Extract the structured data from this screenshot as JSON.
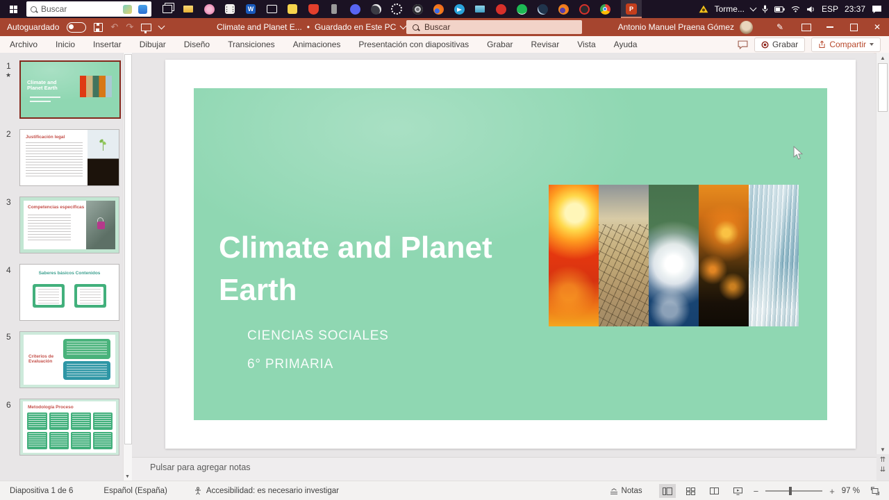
{
  "taskbar": {
    "search_placeholder": "Buscar",
    "app_icons": [
      "task-view",
      "file-explorer",
      "photos",
      "store",
      "word",
      "chat",
      "sticky-notes",
      "brave",
      "phone-link",
      "discord",
      "obs",
      "settings",
      "screen-record",
      "firefox",
      "telegram",
      "mail",
      "camera-record",
      "spotify",
      "steam",
      "firefox-nightly",
      "recorder",
      "chrome",
      "powerpoint"
    ],
    "tray": {
      "weather_label": "Torme...",
      "language": "ESP",
      "time": "23:37"
    }
  },
  "titlebar": {
    "autosave_label": "Autoguardado",
    "doc_title": "Climate and Planet E...",
    "separator": "•",
    "saved_status": "Guardado en Este PC",
    "search_placeholder": "Buscar",
    "user_name": "Antonio Manuel Praena Gómez"
  },
  "ribbon": {
    "tabs": [
      "Archivo",
      "Inicio",
      "Insertar",
      "Dibujar",
      "Diseño",
      "Transiciones",
      "Animaciones",
      "Presentación con diapositivas",
      "Grabar",
      "Revisar",
      "Vista",
      "Ayuda"
    ],
    "record_label": "Grabar",
    "share_label": "Compartir"
  },
  "slides_panel": {
    "thumbnails": [
      {
        "number": "1",
        "title": "Climate and Planet Earth"
      },
      {
        "number": "2",
        "title": "Justificación legal"
      },
      {
        "number": "3",
        "title": "Competencias específicas"
      },
      {
        "number": "4",
        "title": "Saberes básicos Contenidos"
      },
      {
        "number": "5",
        "title": "Criterios de Evaluación"
      },
      {
        "number": "6",
        "title": "Metodología Proceso"
      }
    ]
  },
  "slide": {
    "title": "Climate and Planet Earth",
    "subtitle_line1": "CIENCIAS SOCIALES",
    "subtitle_line2": "6° PRIMARIA"
  },
  "notes": {
    "placeholder": "Pulsar para agregar notas"
  },
  "statusbar": {
    "slide_counter": "Diapositiva 1 de 6",
    "language": "Español (España)",
    "accessibility_status": "Accesibilidad: es necesario investigar",
    "notes_label": "Notas",
    "zoom_level": "97 %"
  },
  "colors": {
    "titlebar_red": "#a6452f",
    "accent_red": "#b7472a",
    "slide_green": "#8fd7b2"
  }
}
